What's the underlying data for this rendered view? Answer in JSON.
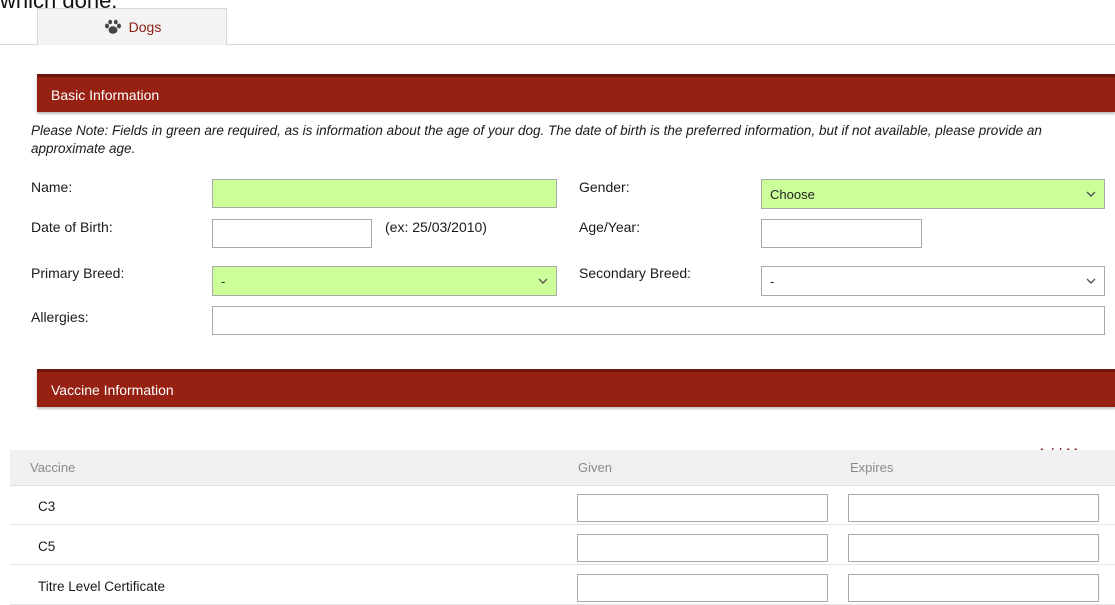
{
  "clipped_top_text": "which done.",
  "tab": {
    "label": "Dogs",
    "icon": "paw-icon"
  },
  "colors": {
    "section_bar": "#962112",
    "required_field": "#ccff99",
    "accent_text": "#8a1d12"
  },
  "basic_info": {
    "title": "Basic Information",
    "note": "Please Note: Fields in green are required, as is information about the age of your dog. The date of birth is the preferred information, but if not available, please provide an approximate age.",
    "name_label": "Name:",
    "name_value": "",
    "gender_label": "Gender:",
    "gender_value": "Choose",
    "dob_label": "Date of Birth:",
    "dob_value": "",
    "dob_hint": "(ex: 25/03/2010)",
    "age_label": "Age/Year:",
    "age_value": "",
    "primary_breed_label": "Primary Breed:",
    "primary_breed_value": "-",
    "secondary_breed_label": "Secondary Breed:",
    "secondary_breed_value": "-",
    "allergies_label": "Allergies:",
    "allergies_value": ""
  },
  "vaccine_info": {
    "title": "Vaccine Information",
    "add_more_label": "Add More",
    "columns": [
      "Vaccine",
      "Given",
      "Expires"
    ],
    "rows": [
      {
        "name": "C3",
        "given": "",
        "expires": ""
      },
      {
        "name": "C5",
        "given": "",
        "expires": ""
      },
      {
        "name": "Titre Level Certificate",
        "given": "",
        "expires": ""
      }
    ]
  }
}
